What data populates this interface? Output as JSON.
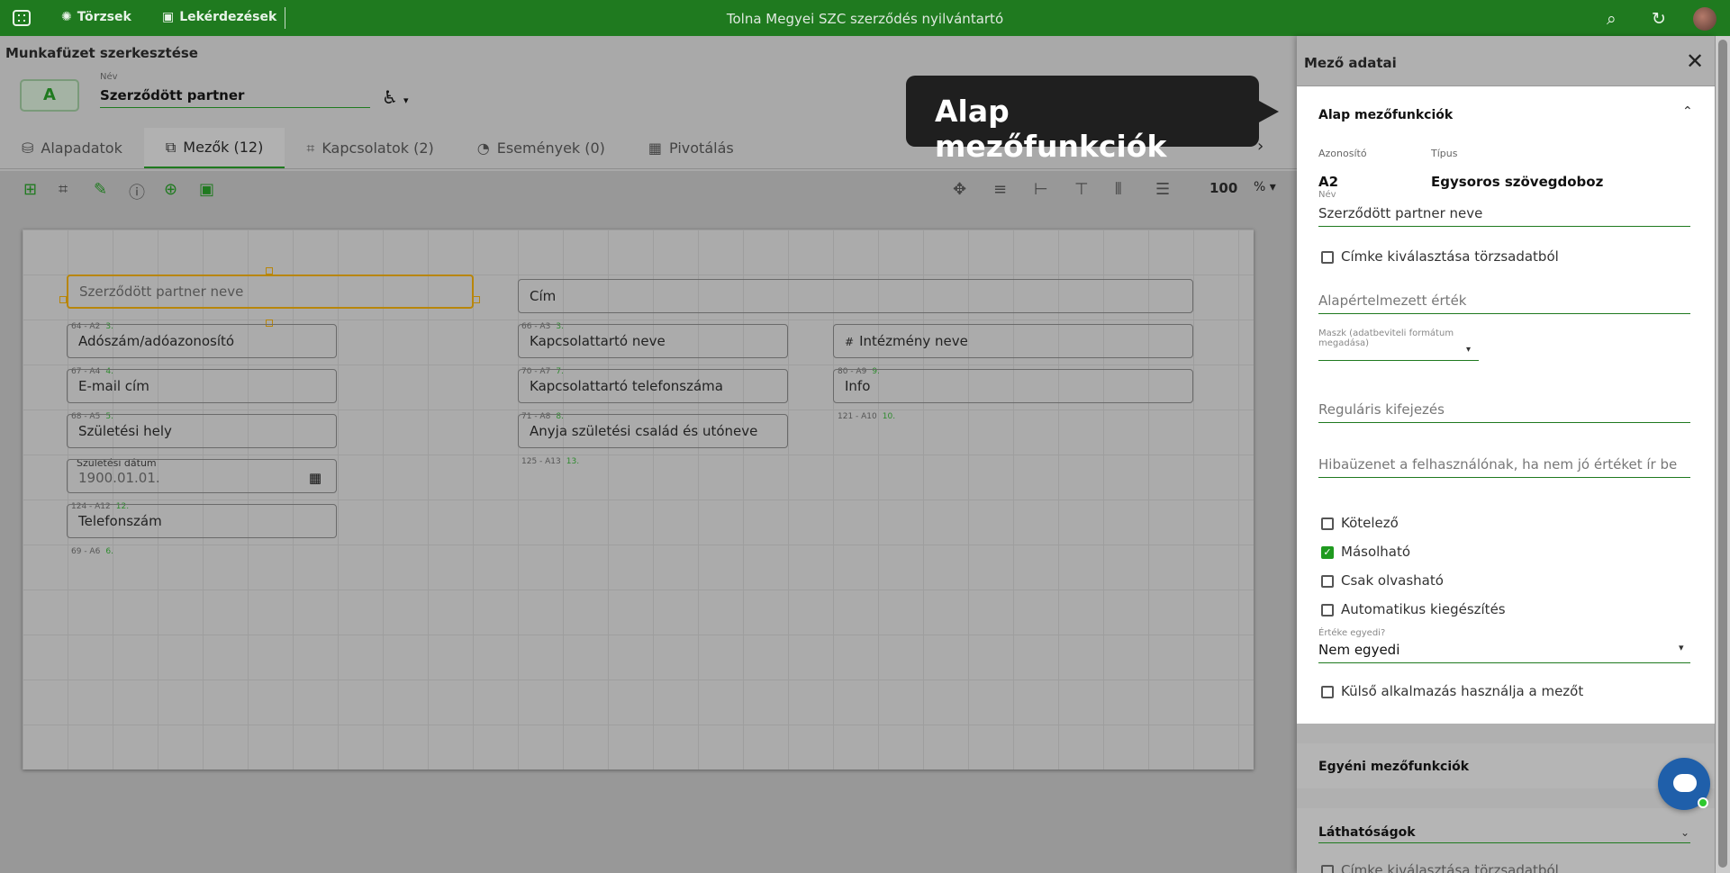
{
  "topbar": {
    "nav1": "Törzsek",
    "nav2": "Lekérdezések",
    "title": "Tolna Megyei SZC szerződés nyilvántartó"
  },
  "page": {
    "title": "Munkafüzet szerkesztése",
    "avatar_letter": "A",
    "name_label": "Név",
    "name_value": "Szerződött partner"
  },
  "tabs": [
    "Alapadatok",
    "Mezők (12)",
    "Kapcsolatok (2)",
    "Események (0)",
    "Pivotálás"
  ],
  "toolbar": {
    "zoom": "100",
    "zoom_unit": "%"
  },
  "tooltip": "Alap mezőfunkciók",
  "fields": [
    {
      "label": "Szerződött partner neve",
      "tag": "",
      "num": ""
    },
    {
      "label": "Adószám/adóazonosító",
      "tag": "64 - A2",
      "num": "3."
    },
    {
      "label": "E-mail cím",
      "tag": "67 - A4",
      "num": "4."
    },
    {
      "label": "Születési hely",
      "tag": "68 - A5",
      "num": "5."
    },
    {
      "label": "1900.01.01.",
      "tag": "Születési dátum",
      "num": ""
    },
    {
      "label": "Telefonszám",
      "tag": "124 - A12",
      "num": "12."
    },
    {
      "label": "",
      "tag": "69 - A6",
      "num": "6."
    },
    {
      "label": "Cím",
      "tag": "",
      "num": ""
    },
    {
      "label": "Kapcsolattartó neve",
      "tag": "66 - A3",
      "num": "3."
    },
    {
      "label": "Kapcsolattartó telefonszáma",
      "tag": "70 - A7",
      "num": "7."
    },
    {
      "label": "Anyja születési család és utóneve",
      "tag": "71 - A8",
      "num": "8."
    },
    {
      "label": "",
      "tag": "125 - A13",
      "num": "13."
    },
    {
      "label": "Intézmény neve",
      "tag": "",
      "num": ""
    },
    {
      "label": "Info",
      "tag": "80 - A9",
      "num": "9."
    },
    {
      "label": "",
      "tag": "121 - A10",
      "num": "10."
    }
  ],
  "panel": {
    "title": "Mező adatai",
    "section": "Alap mezőfunkciók",
    "id_label": "Azonosító",
    "id_value": "A2",
    "type_label": "Típus",
    "type_value": "Egysoros szövegdoboz",
    "name_label": "Név",
    "name_value": "Szerződött partner neve",
    "cb_cimke": "Címke kiválasztása törzsadatból",
    "default_ph": "Alapértelmezett érték",
    "mask_label": "Maszk (adatbeviteli formátum megadása)",
    "regex_ph": "Reguláris kifejezés",
    "error_ph": "Hibaüzenet a felhasználónak, ha nem jó értéket ír be",
    "cb_required": "Kötelező",
    "cb_copyable": "Másolható",
    "cb_readonly": "Csak olvasható",
    "cb_auto": "Automatikus kiegészítés",
    "unique_label": "Értéke egyedi?",
    "unique_value": "Nem egyedi",
    "cb_external": "Külső alkalmazás használja a mezőt",
    "section2": "Egyéni mezőfunkciók",
    "section3": "Láthatóságok",
    "cb_cimke2": "Címke kiválasztása törzsadatból"
  },
  "colors": {
    "brand": "#1f7a1f",
    "accent_check": "#1f9a1f",
    "tooltip_bg": "#1f1f1f",
    "chat": "#1f5faa"
  }
}
